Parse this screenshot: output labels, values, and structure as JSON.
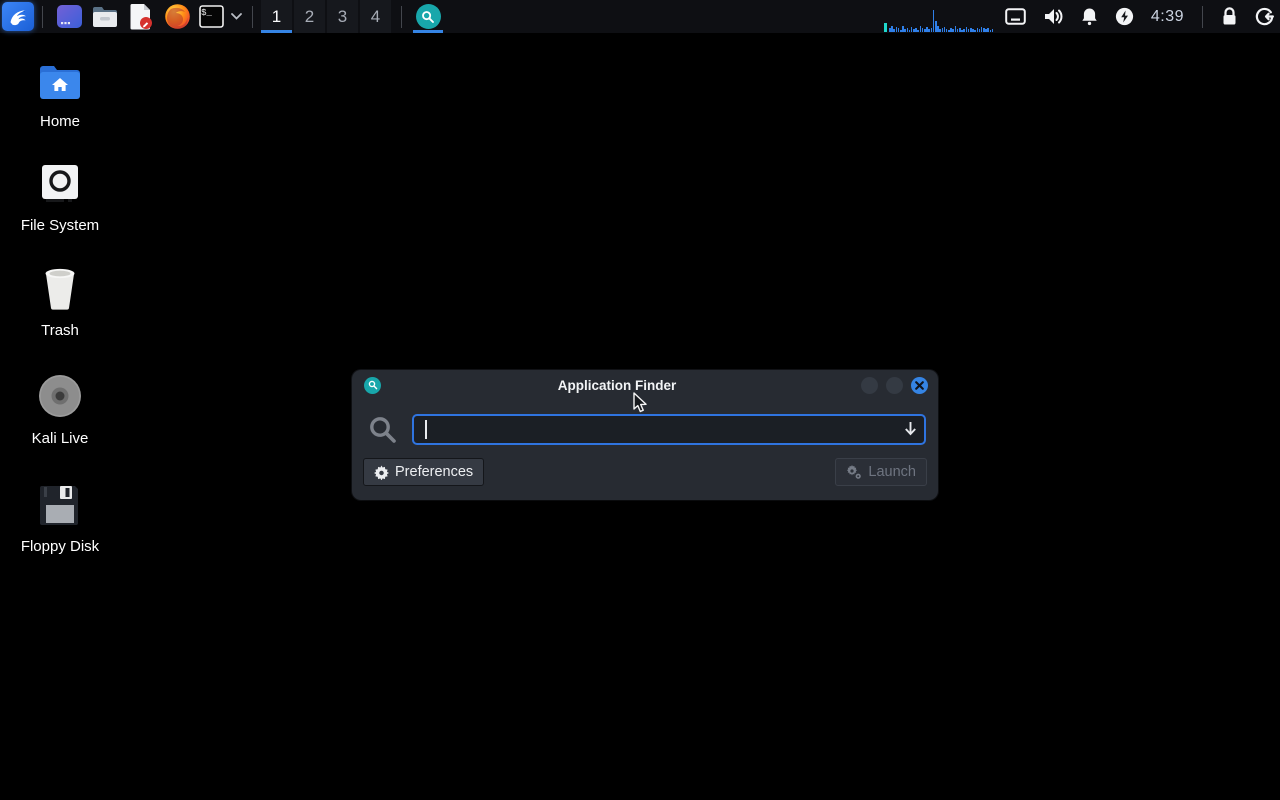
{
  "colors": {
    "accent_blue": "#3584e4",
    "teal": "#18a7ab",
    "cpu_bar": "#2f7fe8",
    "cpu_block": "#1fd8cc"
  },
  "panel": {
    "workspaces": {
      "items": [
        "1",
        "2",
        "3",
        "4"
      ],
      "active_index": 0
    },
    "terminal_prompt": "$_",
    "clock": "4:39",
    "cpu_graph": {
      "bar_color": "#2f7fe8",
      "bars": [
        4,
        6,
        3,
        5,
        4,
        2,
        6,
        3,
        4,
        2,
        5,
        3,
        4,
        2,
        6,
        4,
        3,
        5,
        3,
        4,
        22,
        11,
        6,
        3,
        4,
        5,
        3,
        2,
        4,
        3,
        6,
        3,
        4,
        2,
        3,
        5,
        3,
        4,
        3,
        2,
        4,
        3,
        5,
        4,
        3,
        4,
        2,
        3
      ]
    }
  },
  "desktop": {
    "icons": [
      {
        "label": "Home"
      },
      {
        "label": "File System"
      },
      {
        "label": "Trash"
      },
      {
        "label": "Kali Live"
      },
      {
        "label": "Floppy Disk"
      }
    ]
  },
  "finder_window": {
    "title": "Application Finder",
    "search_value": "",
    "preferences_label": "Preferences",
    "launch_label": "Launch"
  }
}
